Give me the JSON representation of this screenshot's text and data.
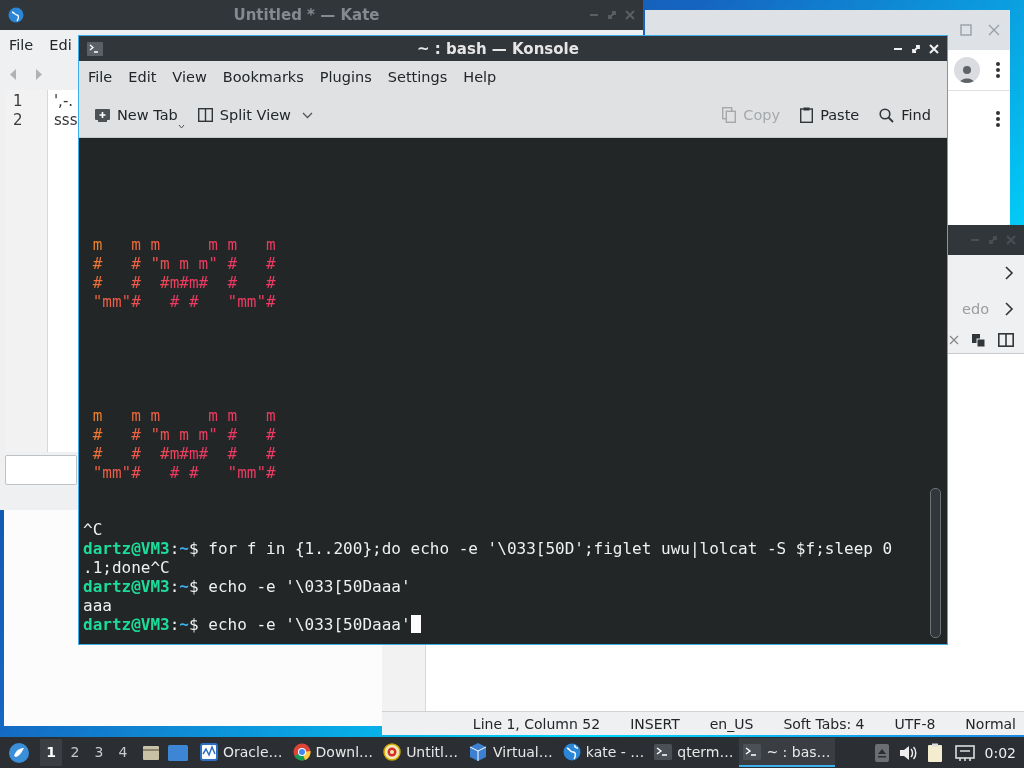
{
  "kate_window": {
    "title": "Untitled * — Kate",
    "menu": [
      "File",
      "Edi"
    ],
    "line_numbers": [
      "1",
      "2"
    ],
    "lines": [
      "',-.",
      "sss"
    ]
  },
  "kate_window_2": {
    "toolbar_label": "edo",
    "status_bar": [
      "Line 1, Column 52",
      "INSERT",
      "en_US",
      "Soft Tabs: 4",
      "UTF-8",
      "Normal"
    ]
  },
  "konsole": {
    "title": "~ : bash — Konsole",
    "menu": [
      "File",
      "Edit",
      "View",
      "Bookmarks",
      "Plugins",
      "Settings",
      "Help"
    ],
    "toolbar_left": [
      {
        "label": "New Tab",
        "kind": "new-tab"
      },
      {
        "label": "Split View",
        "kind": "split"
      }
    ],
    "toolbar_right": [
      {
        "label": "Copy",
        "kind": "copy",
        "disabled": true
      },
      {
        "label": "Paste",
        "kind": "paste",
        "disabled": false
      },
      {
        "label": "Find",
        "kind": "search",
        "disabled": false
      }
    ],
    "terminal": {
      "art_blocks": [
        [
          " m   m m     m m   m",
          " #   # \"m m m\" #   #",
          " #   #  #m#m#  #   #",
          " \"mm\"#   # #   \"mm\"#"
        ],
        [
          " m   m m     m m   m",
          " #   # \"m m m\" #   #",
          " #   #  #m#m#  #   #",
          " \"mm\"#   # #   \"mm\"#"
        ]
      ],
      "lines": [
        {
          "kind": "output",
          "text": "^C"
        },
        {
          "kind": "prompt",
          "user": "dartz@VM3",
          "colon": ":",
          "path": "~",
          "symbol": "$",
          "command": " for f in {1..200};do echo -e '\\033[50D';figlet uwu|lolcat -S $f;sleep 0",
          "cursor": false
        },
        {
          "kind": "output",
          "text": ".1;done^C"
        },
        {
          "kind": "prompt",
          "user": "dartz@VM3",
          "colon": ":",
          "path": "~",
          "symbol": "$",
          "command": " echo -e '\\033[50Daaa'",
          "cursor": false
        },
        {
          "kind": "output",
          "text": "aaa"
        },
        {
          "kind": "prompt",
          "user": "dartz@VM3",
          "colon": ":",
          "path": "~",
          "symbol": "$",
          "command": " echo -e '\\033[50Daaa'",
          "cursor": true
        }
      ]
    }
  },
  "taskbar": {
    "desktops": [
      {
        "label": "1",
        "selected": true
      },
      {
        "label": "2",
        "selected": false
      },
      {
        "label": "3",
        "selected": false
      },
      {
        "label": "4",
        "selected": false
      }
    ],
    "tasks": [
      {
        "label": "Oracle…",
        "kind": "monitor",
        "selected": false
      },
      {
        "label": "Downl…",
        "kind": "browser",
        "selected": false
      },
      {
        "label": "Untitl…",
        "kind": "ring",
        "selected": false
      },
      {
        "label": "Virtual…",
        "kind": "vm",
        "selected": false
      },
      {
        "label": "kate - …",
        "kind": "globe",
        "selected": false
      },
      {
        "label": "qterm…",
        "kind": "terminal",
        "selected": false
      },
      {
        "label": "~ : bas…",
        "kind": "terminal",
        "selected": true
      }
    ],
    "clock": "0:02"
  }
}
